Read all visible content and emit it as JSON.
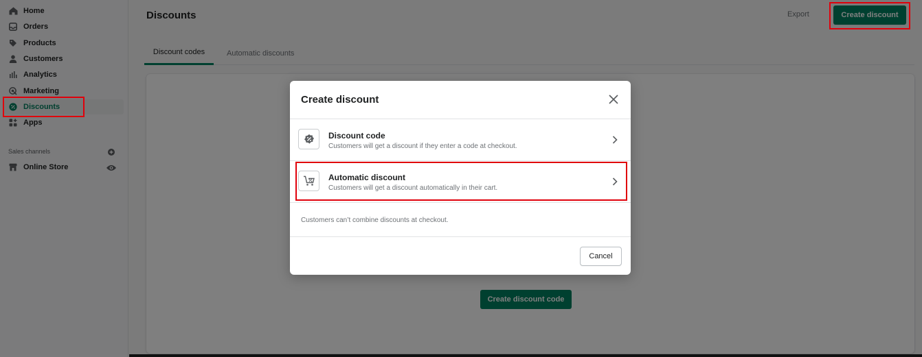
{
  "sidebar": {
    "items": [
      {
        "label": "Home",
        "icon": "home-icon"
      },
      {
        "label": "Orders",
        "icon": "orders-icon"
      },
      {
        "label": "Products",
        "icon": "tag-icon"
      },
      {
        "label": "Customers",
        "icon": "person-icon"
      },
      {
        "label": "Analytics",
        "icon": "bar-chart-icon"
      },
      {
        "label": "Marketing",
        "icon": "target-icon"
      },
      {
        "label": "Discounts",
        "icon": "discount-icon",
        "active": true
      },
      {
        "label": "Apps",
        "icon": "apps-icon"
      }
    ],
    "sales_channels_label": "Sales channels",
    "online_store_label": "Online Store"
  },
  "page": {
    "title": "Discounts",
    "export_label": "Export",
    "create_discount_label": "Create discount",
    "tabs": [
      {
        "label": "Discount codes",
        "selected": true
      },
      {
        "label": "Automatic discounts",
        "selected": false
      }
    ],
    "card_cta_label": "Create discount code"
  },
  "modal": {
    "title": "Create discount",
    "options": [
      {
        "title": "Discount code",
        "description": "Customers will get a discount if they enter a code at checkout."
      },
      {
        "title": "Automatic discount",
        "description": "Customers will get a discount automatically in their cart."
      }
    ],
    "note": "Customers can’t combine discounts at checkout.",
    "cancel_label": "Cancel"
  },
  "colors": {
    "brand_green": "#008060",
    "highlight_red": "#e0000b",
    "overlay": "rgba(0,0,0,0.5)"
  }
}
